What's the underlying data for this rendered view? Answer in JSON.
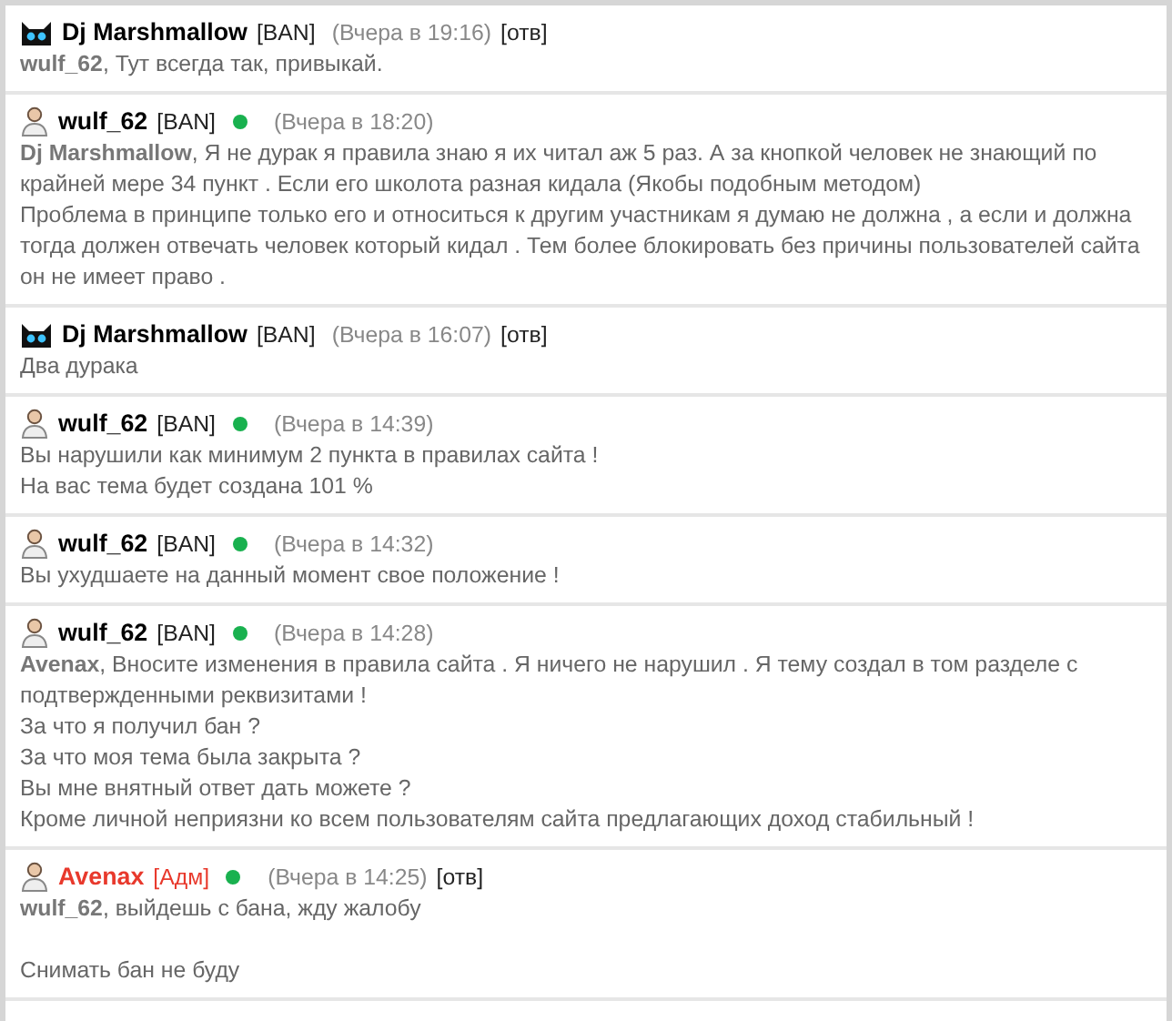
{
  "posts": [
    {
      "kind": "cat",
      "author": "Dj Marshmallow",
      "color": "#000000",
      "badge": "[BAN]",
      "online": false,
      "time": "(Вчера в 19:16)",
      "reply": "[отв]",
      "paragraphs": [
        [
          "**wulf_62**, Тут всегда так, привыкай."
        ]
      ]
    },
    {
      "kind": "person",
      "author": "wulf_62",
      "color": "#000000",
      "badge": "[BAN]",
      "online": true,
      "time": "(Вчера в 18:20)",
      "paragraphs": [
        [
          "**Dj Marshmallow**, Я не дурак я правила знаю я их читал аж 5 раз. А за кнопкой человек не знающий по крайней мере 34 пункт . Если его школота разная кидала (Якобы подобным методом)",
          "Проблема в принципе только его и относиться к другим участникам я думаю не должна , а если и должна тогда должен отвечать человек который кидал . Тем более блокировать без причины пользователей сайта он не имеет право ."
        ]
      ]
    },
    {
      "kind": "cat",
      "author": "Dj Marshmallow",
      "color": "#000000",
      "badge": "[BAN]",
      "online": false,
      "time": "(Вчера в 16:07)",
      "reply": "[отв]",
      "paragraphs": [
        [
          "Два дурака"
        ]
      ]
    },
    {
      "kind": "person",
      "author": "wulf_62",
      "color": "#000000",
      "badge": "[BAN]",
      "online": true,
      "time": "(Вчера в 14:39)",
      "paragraphs": [
        [
          "Вы нарушили как минимум 2 пункта в правилах сайта !",
          "На вас тема будет создана 101 %"
        ]
      ]
    },
    {
      "kind": "person",
      "author": "wulf_62",
      "color": "#000000",
      "badge": "[BAN]",
      "online": true,
      "time": "(Вчера в 14:32)",
      "paragraphs": [
        [
          "Вы ухудшаете на данный момент свое положение !"
        ]
      ]
    },
    {
      "kind": "person",
      "author": "wulf_62",
      "color": "#000000",
      "badge": "[BAN]",
      "online": true,
      "time": "(Вчера в 14:28)",
      "paragraphs": [
        [
          "**Avenax**, Вносите изменения в правила сайта . Я ничего не нарушил . Я тему создал в том разделе с подтвержденными реквизитами !",
          "За что я получил бан ?",
          "За что моя тема была закрыта ?",
          "Вы мне внятный ответ дать можете ?",
          "Кроме личной неприязни ко всем пользователям сайта предлагающих доход стабильный !"
        ]
      ]
    },
    {
      "kind": "person",
      "author": "Avenax",
      "color": "#e8392c",
      "badge": "[Адм]",
      "online": true,
      "time": "(Вчера в 14:25)",
      "reply": "[отв]",
      "paragraphs": [
        [
          "**wulf_62**, выйдешь с бана, жду жалобу"
        ],
        [
          "Снимать бан не буду"
        ]
      ]
    }
  ]
}
